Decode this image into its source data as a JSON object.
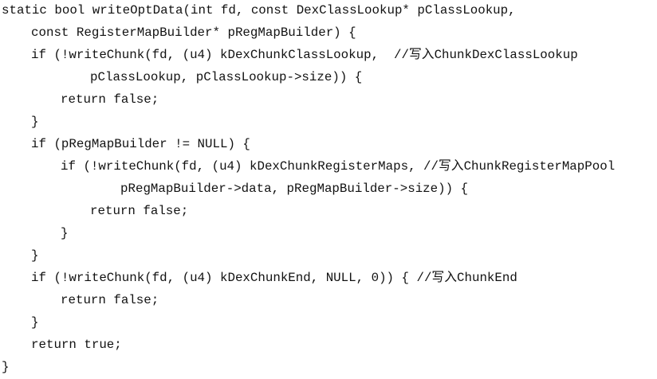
{
  "code_lines": [
    "static bool writeOptData(int fd, const DexClassLookup* pClassLookup,",
    "const RegisterMapBuilder* pRegMapBuilder) {",
    "if (!writeChunk(fd, (u4) kDexChunkClassLookup,  //写入ChunkDexClassLookup",
    "pClassLookup, pClassLookup->size)) {",
    "return false;",
    "}",
    "if (pRegMapBuilder != NULL) {",
    "if (!writeChunk(fd, (u4) kDexChunkRegisterMaps, //写入ChunkRegisterMapPool",
    "pRegMapBuilder->data, pRegMapBuilder->size)) {",
    "return false;",
    "}",
    "}",
    "if (!writeChunk(fd, (u4) kDexChunkEnd, NULL, 0)) { //写入ChunkEnd",
    "return false;",
    "}",
    "return true;",
    "}"
  ]
}
